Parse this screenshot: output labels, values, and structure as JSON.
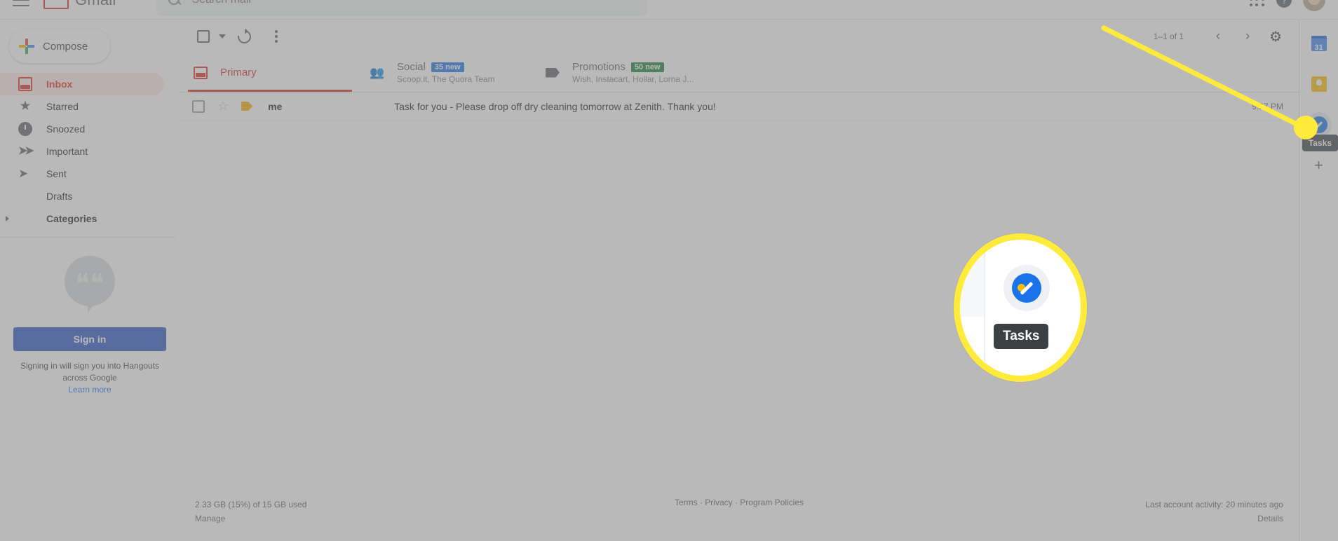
{
  "header": {
    "menu_icon": "hamburger-icon",
    "logo_text": "Gmail",
    "search_placeholder": "Search mail",
    "search_value": "",
    "search_icon": "search-icon",
    "apps_icon": "apps-grid-icon",
    "help_icon": "help-icon",
    "avatar": "account-avatar"
  },
  "sidebar": {
    "compose_label": "Compose",
    "compose_icon": "plus-icon",
    "items": [
      {
        "label": "Inbox",
        "icon": "inbox-icon",
        "active": true
      },
      {
        "label": "Starred",
        "icon": "star-icon",
        "active": false
      },
      {
        "label": "Snoozed",
        "icon": "clock-icon",
        "active": false
      },
      {
        "label": "Important",
        "icon": "important-icon",
        "active": false
      },
      {
        "label": "Sent",
        "icon": "send-icon",
        "active": false
      },
      {
        "label": "Drafts",
        "icon": "draft-icon",
        "active": false
      },
      {
        "label": "Categories",
        "icon": "tag-icon",
        "active": false
      }
    ],
    "hangouts": {
      "icon": "hangouts-bubble-icon",
      "signin_label": "Sign in",
      "note_line1": "Signing in will sign you into Hangouts",
      "note_line2": "across Google",
      "learn_more": "Learn more"
    }
  },
  "toolbar": {
    "select_all_icon": "checkbox-icon",
    "select_caret_icon": "chevron-down-icon",
    "refresh_icon": "refresh-icon",
    "more_icon": "more-vertical-icon",
    "pager_text": "1–1 of 1",
    "prev_icon": "chevron-left-icon",
    "next_icon": "chevron-right-icon",
    "settings_icon": "gear-icon"
  },
  "tabs": [
    {
      "label": "Primary",
      "icon": "inbox-tab-icon",
      "badge": "",
      "badge_color": "",
      "subtitle": "",
      "active": true
    },
    {
      "label": "Social",
      "icon": "people-icon",
      "badge": "35 new",
      "badge_color": "#1a73e8",
      "subtitle": "Scoop.it, The Quora Team",
      "active": false
    },
    {
      "label": "Promotions",
      "icon": "tag-tab-icon",
      "badge": "50 new",
      "badge_color": "#188038",
      "subtitle": "Wish, Instacart, Hollar, Lorna J...",
      "active": false
    }
  ],
  "mail_rows": [
    {
      "checkbox_icon": "checkbox-icon",
      "star_icon": "star-icon",
      "important_icon": "important-marker-icon",
      "sender": "me",
      "subject": "Task for you - Please drop off dry cleaning tomorrow at Zenith. Thank you!",
      "time": "9:27 PM"
    }
  ],
  "footer": {
    "storage": "2.33 GB (15%) of 15 GB used",
    "manage": "Manage",
    "links": "Terms · Privacy · Program Policies",
    "activity": "Last account activity: 20 minutes ago",
    "details": "Details"
  },
  "rail": {
    "items": [
      {
        "label": "Calendar",
        "icon": "calendar-icon",
        "glyph": "31"
      },
      {
        "label": "Keep",
        "icon": "keep-icon",
        "glyph": ""
      },
      {
        "label": "Tasks",
        "icon": "tasks-icon",
        "glyph": ""
      }
    ],
    "add_label": "Add",
    "add_icon": "plus-icon",
    "tooltip": "Tasks"
  },
  "callout": {
    "tooltip": "Tasks",
    "highlight_color": "#ffeb3b",
    "target": "tasks-icon"
  }
}
